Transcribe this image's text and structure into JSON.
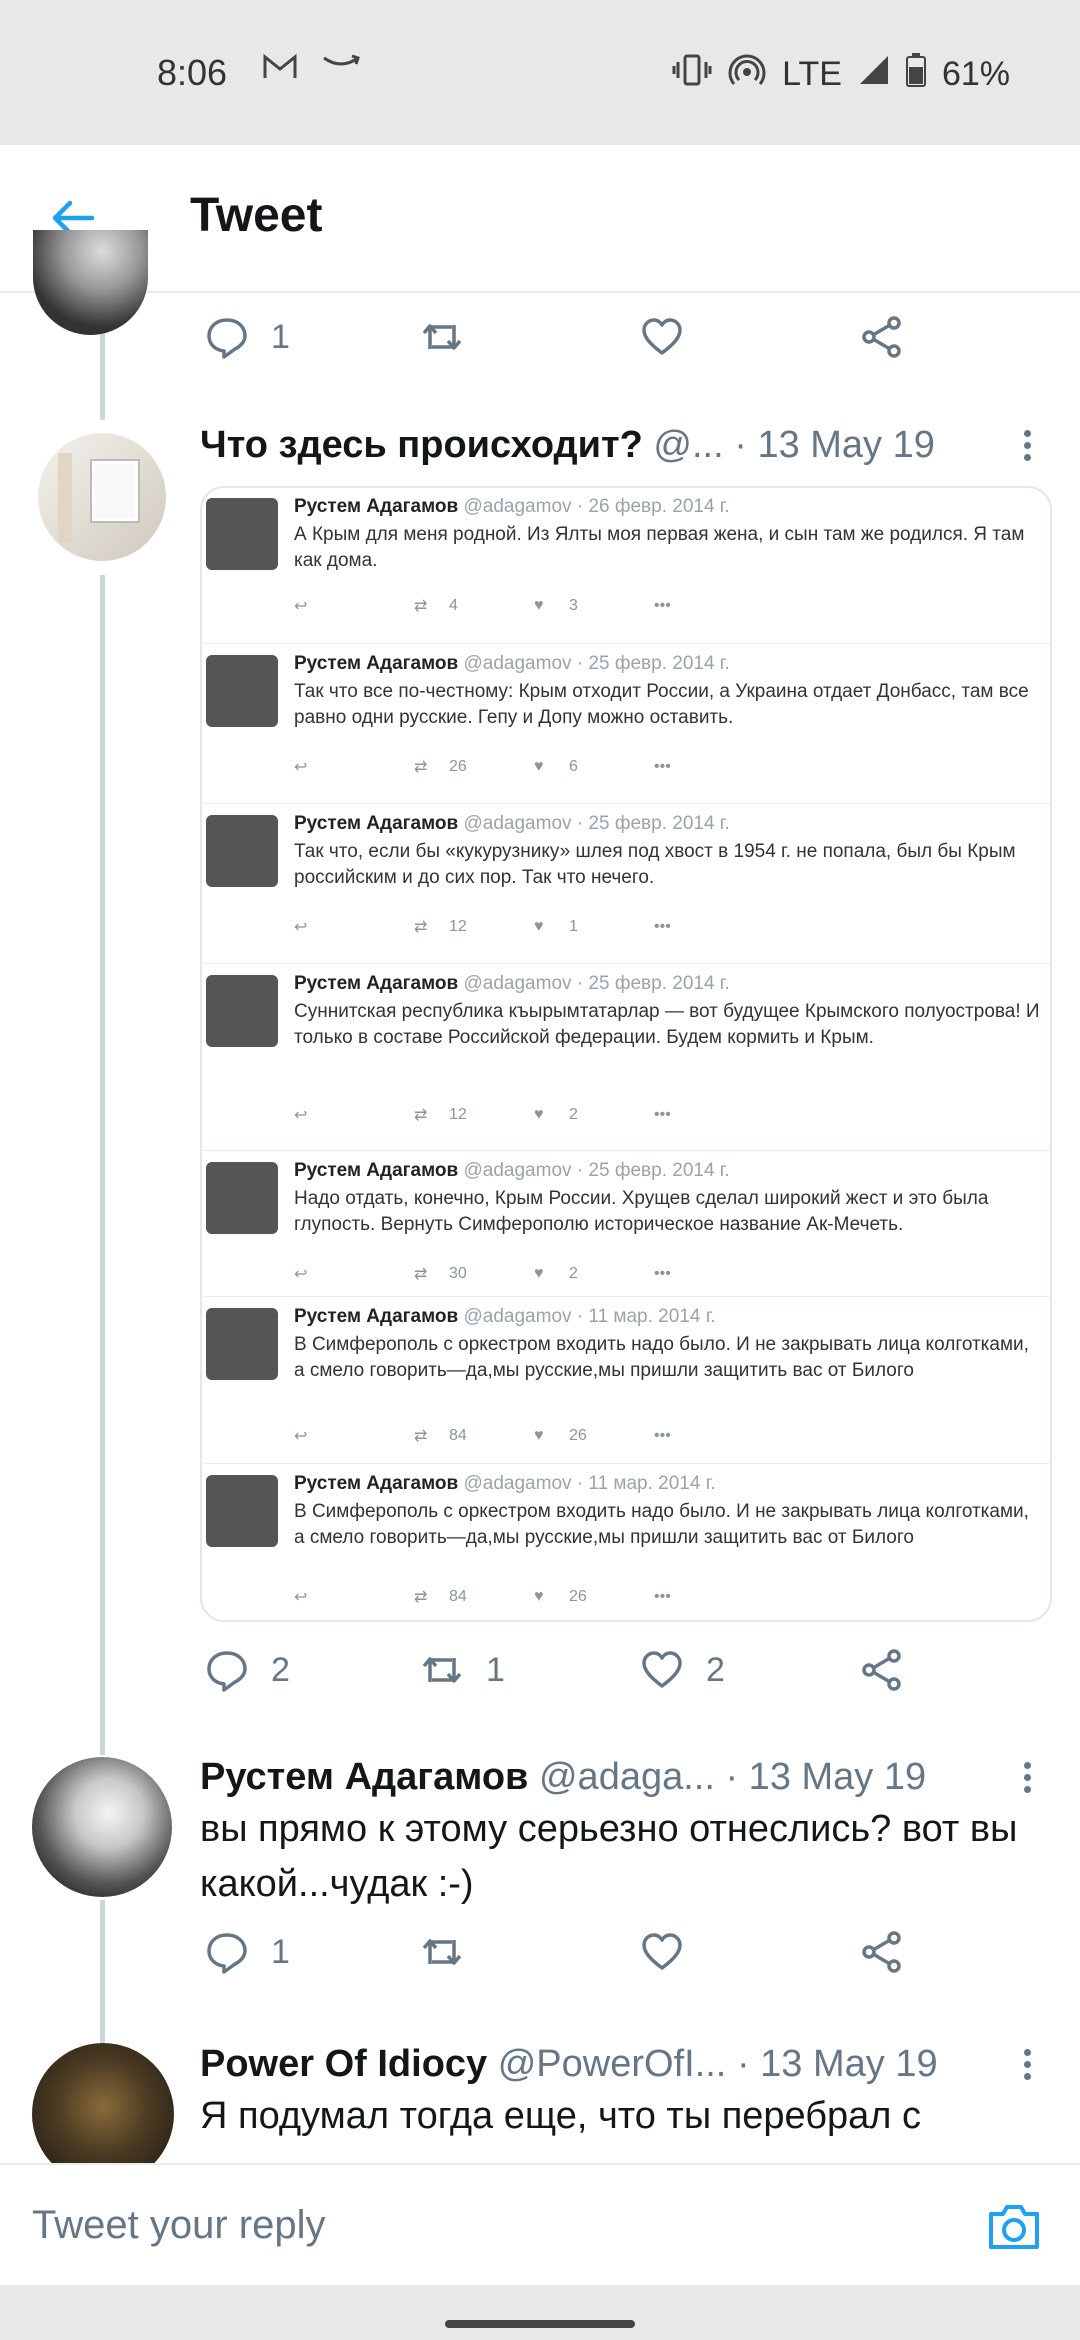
{
  "status_bar": {
    "time": "8:06",
    "network": "LTE",
    "battery": "61%"
  },
  "header": {
    "title": "Tweet"
  },
  "top_tweet": {
    "replies": "1",
    "retweets": "",
    "likes": ""
  },
  "tweets": [
    {
      "name": "Что здесь происходит?",
      "handle": "@...",
      "date": "· 13 May 19",
      "replies": "2",
      "retweets": "1",
      "likes": "2",
      "embedded": [
        {
          "name": "Рустем Адагамов",
          "handle": "@adagamov",
          "date": "· 26 февр. 2014 г.",
          "text": "А Крым для меня родной. Из Ялты моя первая жена, и сын там же родился. Я там как дома.",
          "retweets": "4",
          "likes": "3"
        },
        {
          "name": "Рустем Адагамов",
          "handle": "@adagamov",
          "date": "· 25 февр. 2014 г.",
          "text": "Так что все по-честному: Крым отходит России, а Украина отдает Донбасс, там все равно одни русские. Гепу и Допу можно оставить.",
          "retweets": "26",
          "likes": "6"
        },
        {
          "name": "Рустем Адагамов",
          "handle": "@adagamov",
          "date": "· 25 февр. 2014 г.",
          "text": "Так что, если бы «кукурузнику» шлея под хвост в 1954 г. не попала, был бы Крым российским и до сих пор. Так что нечего.",
          "retweets": "12",
          "likes": "1"
        },
        {
          "name": "Рустем Адагамов",
          "handle": "@adagamov",
          "date": "· 25 февр. 2014 г.",
          "text": "Суннитская республика къырымтатарлар — вот будущее Крымского полуострова! И только в составе Российской федерации. Будем кормить и Крым.",
          "retweets": "12",
          "likes": "2"
        },
        {
          "name": "Рустем Адагамов",
          "handle": "@adagamov",
          "date": "· 25 февр. 2014 г.",
          "text": "Надо отдать, конечно, Крым России. Хрущев сделал широкий жест и это была глупость. Вернуть Симферополю историческое название Ак-Мечеть.",
          "retweets": "30",
          "likes": "2"
        },
        {
          "name": "Рустем Адагамов",
          "handle": "@adagamov",
          "date": "· 11 мар. 2014 г.",
          "text": "В Симферополь с оркестром входить надо было. И не закрывать лица колготками, а смело говорить—да,мы русские,мы пришли защитить вас от Билого",
          "retweets": "84",
          "likes": "26"
        },
        {
          "name": "Рустем Адагамов",
          "handle": "@adagamov",
          "date": "· 11 мар. 2014 г.",
          "text": "В Симферополь с оркестром входить надо было. И не закрывать лица колготками, а смело говорить—да,мы русские,мы пришли защитить вас от Билого",
          "retweets": "84",
          "likes": "26"
        }
      ]
    },
    {
      "name": "Рустем Адагамов",
      "handle": "@adaga...",
      "date": "· 13 May 19",
      "text": "вы прямо к этому серьезно отнеслись? вот вы какой...чудак :-)",
      "replies": "1",
      "retweets": "",
      "likes": ""
    },
    {
      "name": "Power Of Idiocy",
      "handle": "@PowerOfI...",
      "date": "· 13 May 19",
      "text": "Я подумал тогда еще, что ты перебрал с красным сухим и пошел возводиться в"
    }
  ],
  "reply_bar": {
    "placeholder": "Tweet your reply"
  },
  "icons": {
    "back": "arrow-left-icon",
    "reply": "speech-bubble-icon",
    "retweet": "retweet-icon",
    "like": "heart-icon",
    "share": "share-icon",
    "more": "vertical-dots-icon",
    "camera": "camera-icon"
  },
  "colors": {
    "accent": "#1da1f2",
    "muted": "#657786",
    "text": "#14171a"
  }
}
